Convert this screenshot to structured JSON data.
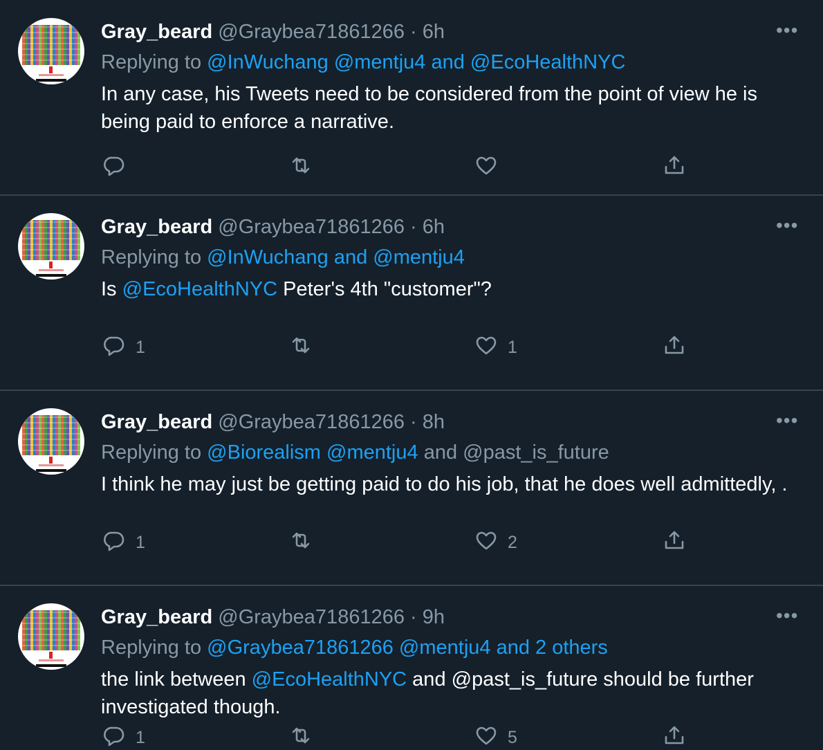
{
  "tweets": [
    {
      "name": "Gray_beard",
      "handle": "@Graybea71861266",
      "sep": "·",
      "time": "6h",
      "more": "•••",
      "replying_to": "Replying to",
      "reply_parts": [
        {
          "text": "@InWuchang @mentju4 and @EcoHealthNYC",
          "link": true
        }
      ],
      "body_parts": [
        {
          "text": "In any case, his Tweets need to be considered from the point of view he is being paid to enforce a narrative.",
          "link": false
        }
      ],
      "reply_count": "",
      "like_count": ""
    },
    {
      "name": "Gray_beard",
      "handle": "@Graybea71861266",
      "sep": "·",
      "time": "6h",
      "more": "•••",
      "replying_to": "Replying to",
      "reply_parts": [
        {
          "text": "@InWuchang and @mentju4",
          "link": true
        }
      ],
      "body_parts": [
        {
          "text": "Is ",
          "link": false
        },
        {
          "text": "@EcoHealthNYC",
          "link": true
        },
        {
          "text": " Peter's 4th \"customer\"?",
          "link": false
        }
      ],
      "reply_count": "1",
      "like_count": "1"
    },
    {
      "name": "Gray_beard",
      "handle": "@Graybea71861266",
      "sep": "·",
      "time": "8h",
      "more": "•••",
      "replying_to": "Replying to",
      "reply_parts": [
        {
          "text": "@Biorealism @mentju4",
          "link": true
        },
        {
          "text": " and @past_is_future",
          "link": false
        }
      ],
      "body_parts": [
        {
          "text": "I think he may just be getting paid to do his job, that he does well admittedly, .",
          "link": false
        }
      ],
      "reply_count": "1",
      "like_count": "2"
    },
    {
      "name": "Gray_beard",
      "handle": "@Graybea71861266",
      "sep": "·",
      "time": "9h",
      "more": "•••",
      "replying_to": "Replying to",
      "reply_parts": [
        {
          "text": "@Graybea71861266 @mentju4 and 2 others",
          "link": true
        }
      ],
      "body_parts": [
        {
          "text": "the link between ",
          "link": false
        },
        {
          "text": "@EcoHealthNYC",
          "link": true
        },
        {
          "text": " and @past_is_future should be further investigated though.",
          "link": false
        }
      ],
      "reply_count": "1",
      "like_count": "5"
    }
  ],
  "icons": [
    "reply-icon",
    "retweet-icon",
    "like-icon",
    "share-icon",
    "more-icon"
  ],
  "colors": {
    "background": "#15202b",
    "link": "#1da1f2",
    "muted": "#8899a6",
    "divider": "#38444d"
  }
}
